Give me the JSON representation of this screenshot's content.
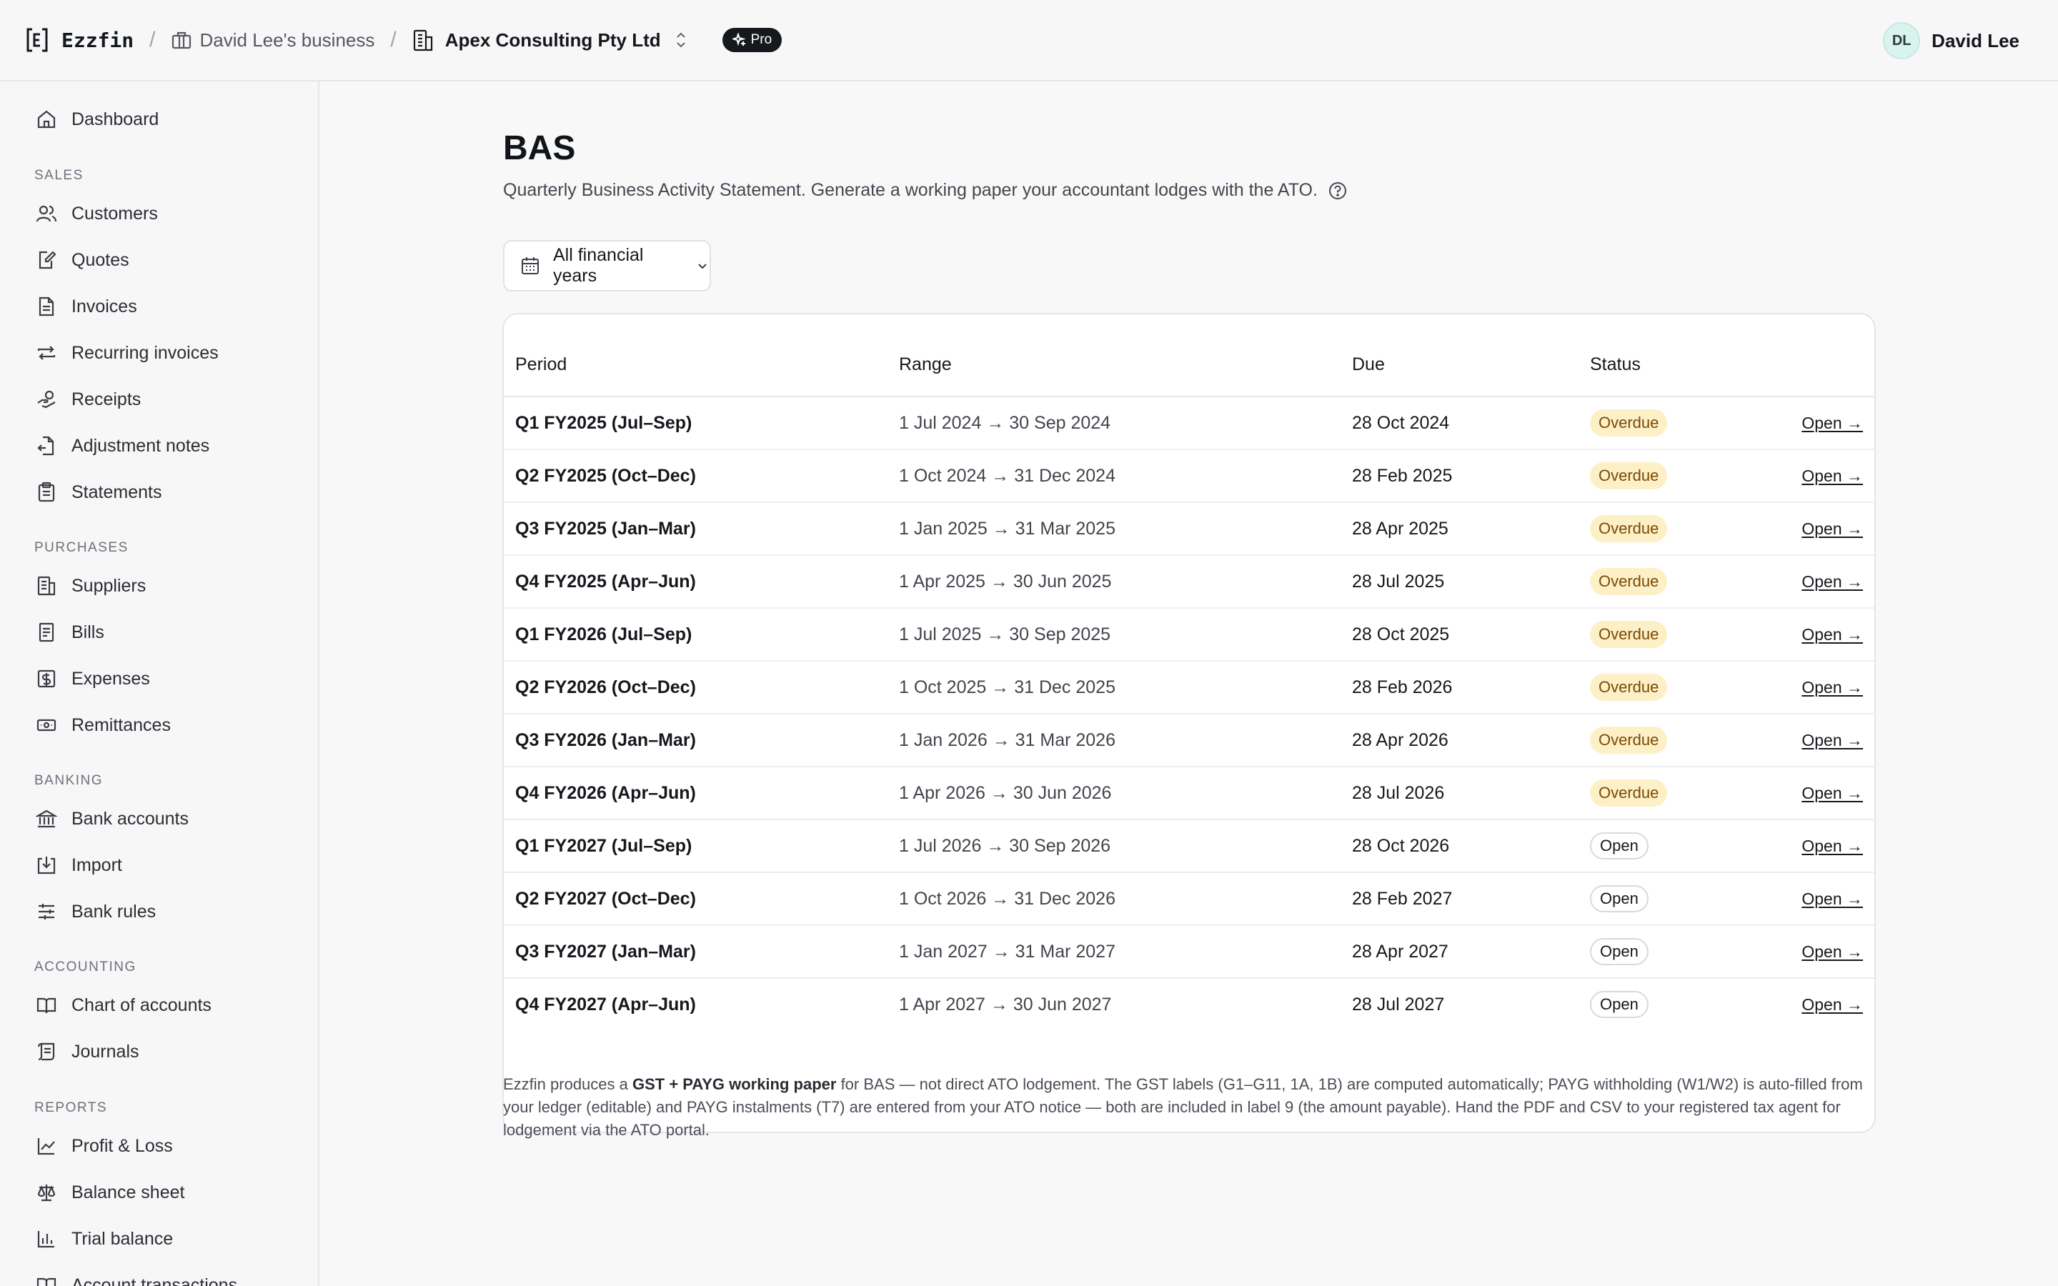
{
  "topbar": {
    "brand": "Ezzfin",
    "business": "David Lee's business",
    "company": "Apex Consulting Pty Ltd",
    "plan_badge": "Pro",
    "user_initials": "DL",
    "user_name": "David Lee"
  },
  "sidebar": {
    "dashboard": "Dashboard",
    "sections": {
      "sales": "SALES",
      "purchases": "PURCHASES",
      "banking": "BANKING",
      "accounting": "ACCOUNTING",
      "reports": "REPORTS"
    },
    "items": {
      "customers": "Customers",
      "quotes": "Quotes",
      "invoices": "Invoices",
      "recurring": "Recurring invoices",
      "receipts": "Receipts",
      "adjustment": "Adjustment notes",
      "statements": "Statements",
      "suppliers": "Suppliers",
      "bills": "Bills",
      "expenses": "Expenses",
      "remittances": "Remittances",
      "bank_accounts": "Bank accounts",
      "import": "Import",
      "bank_rules": "Bank rules",
      "chart_of_accounts": "Chart of accounts",
      "journals": "Journals",
      "profit_loss": "Profit & Loss",
      "balance_sheet": "Balance sheet",
      "trial_balance": "Trial balance",
      "account_transactions": "Account transactions"
    }
  },
  "page": {
    "title": "BAS",
    "subtitle": "Quarterly Business Activity Statement. Generate a working paper your accountant lodges with the ATO.",
    "filter_value": "All financial years"
  },
  "table": {
    "headers": {
      "period": "Period",
      "range": "Range",
      "due": "Due",
      "status": "Status"
    },
    "action_label": "Open →",
    "rows": [
      {
        "period": "Q1 FY2025 (Jul–Sep)",
        "range": "1 Jul 2024 → 30 Sep 2024",
        "due": "28 Oct 2024",
        "status": "Overdue"
      },
      {
        "period": "Q2 FY2025 (Oct–Dec)",
        "range": "1 Oct 2024 → 31 Dec 2024",
        "due": "28 Feb 2025",
        "status": "Overdue"
      },
      {
        "period": "Q3 FY2025 (Jan–Mar)",
        "range": "1 Jan 2025 → 31 Mar 2025",
        "due": "28 Apr 2025",
        "status": "Overdue"
      },
      {
        "period": "Q4 FY2025 (Apr–Jun)",
        "range": "1 Apr 2025 → 30 Jun 2025",
        "due": "28 Jul 2025",
        "status": "Overdue"
      },
      {
        "period": "Q1 FY2026 (Jul–Sep)",
        "range": "1 Jul 2025 → 30 Sep 2025",
        "due": "28 Oct 2025",
        "status": "Overdue"
      },
      {
        "period": "Q2 FY2026 (Oct–Dec)",
        "range": "1 Oct 2025 → 31 Dec 2025",
        "due": "28 Feb 2026",
        "status": "Overdue"
      },
      {
        "period": "Q3 FY2026 (Jan–Mar)",
        "range": "1 Jan 2026 → 31 Mar 2026",
        "due": "28 Apr 2026",
        "status": "Overdue"
      },
      {
        "period": "Q4 FY2026 (Apr–Jun)",
        "range": "1 Apr 2026 → 30 Jun 2026",
        "due": "28 Jul 2026",
        "status": "Overdue"
      },
      {
        "period": "Q1 FY2027 (Jul–Sep)",
        "range": "1 Jul 2026 → 30 Sep 2026",
        "due": "28 Oct 2026",
        "status": "Open"
      },
      {
        "period": "Q2 FY2027 (Oct–Dec)",
        "range": "1 Oct 2026 → 31 Dec 2026",
        "due": "28 Feb 2027",
        "status": "Open"
      },
      {
        "period": "Q3 FY2027 (Jan–Mar)",
        "range": "1 Jan 2027 → 31 Mar 2027",
        "due": "28 Apr 2027",
        "status": "Open"
      },
      {
        "period": "Q4 FY2027 (Apr–Jun)",
        "range": "1 Apr 2027 → 30 Jun 2027",
        "due": "28 Jul 2027",
        "status": "Open"
      }
    ]
  },
  "footnote": {
    "part1": "Ezzfin produces a ",
    "bold": "GST + PAYG working paper",
    "part2": " for BAS — not direct ATO lodgement. The GST labels (G1–G11, 1A, 1B) are computed automatically; PAYG withholding (W1/W2) is auto-filled from your ledger (editable) and PAYG instalments (T7) are entered from your ATO notice — both are included in label 9 (the amount payable). Hand the PDF and CSV to your registered tax agent for lodgement via the ATO portal."
  },
  "colors": {
    "overdue_bg": "#fdf0c6",
    "overdue_text": "#7a4a06",
    "open_border": "#d7d9dd",
    "avatar_bg": "#d9f3ee"
  }
}
